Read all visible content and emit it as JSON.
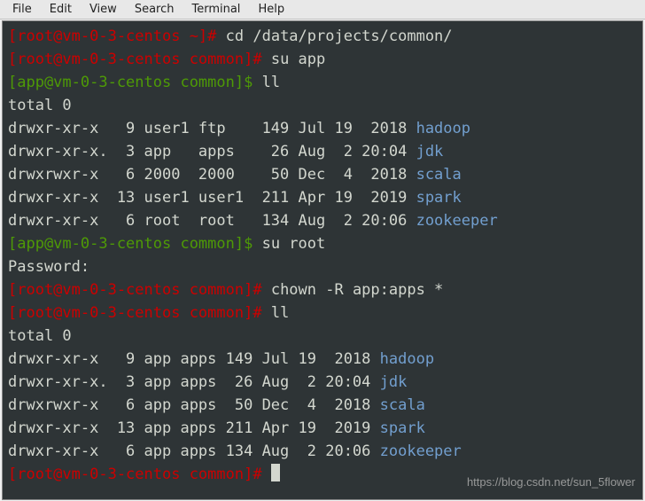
{
  "menubar": {
    "items": [
      "File",
      "Edit",
      "View",
      "Search",
      "Terminal",
      "Help"
    ]
  },
  "terminal": {
    "lines": [
      {
        "type": "prompt_root_home",
        "user": "root",
        "host": "vm-0-3-centos",
        "dir": "~",
        "sym": "#",
        "cmd": "cd /data/projects/common/"
      },
      {
        "type": "prompt_root",
        "user": "root",
        "host": "vm-0-3-centos",
        "dir": "common",
        "sym": "#",
        "cmd": "su app"
      },
      {
        "type": "prompt_app",
        "user": "app",
        "host": "vm-0-3-centos",
        "dir": "common",
        "sym": "$",
        "cmd": "ll"
      },
      {
        "type": "text",
        "text": "total 0"
      },
      {
        "type": "ls",
        "perm": "drwxr-xr-x ",
        "n": "  9",
        "u": "user1",
        "g": "ftp  ",
        "sz": " 149",
        "date": "Jul 19  2018",
        "name": "hadoop"
      },
      {
        "type": "ls",
        "perm": "drwxr-xr-x.",
        "n": "  3",
        "u": "app  ",
        "g": "apps ",
        "sz": "  26",
        "date": "Aug  2 20:04",
        "name": "jdk"
      },
      {
        "type": "ls",
        "perm": "drwxrwxr-x ",
        "n": "  6",
        "u": "2000 ",
        "g": "2000 ",
        "sz": "  50",
        "date": "Dec  4  2018",
        "name": "scala"
      },
      {
        "type": "ls",
        "perm": "drwxr-xr-x ",
        "n": " 13",
        "u": "user1",
        "g": "user1",
        "sz": " 211",
        "date": "Apr 19  2019",
        "name": "spark"
      },
      {
        "type": "ls",
        "perm": "drwxr-xr-x ",
        "n": "  6",
        "u": "root ",
        "g": "root ",
        "sz": " 134",
        "date": "Aug  2 20:06",
        "name": "zookeeper"
      },
      {
        "type": "prompt_app",
        "user": "app",
        "host": "vm-0-3-centos",
        "dir": "common",
        "sym": "$",
        "cmd": "su root"
      },
      {
        "type": "text",
        "text": "Password:"
      },
      {
        "type": "prompt_root",
        "user": "root",
        "host": "vm-0-3-centos",
        "dir": "common",
        "sym": "#",
        "cmd": "chown -R app:apps *"
      },
      {
        "type": "prompt_root",
        "user": "root",
        "host": "vm-0-3-centos",
        "dir": "common",
        "sym": "#",
        "cmd": "ll"
      },
      {
        "type": "text",
        "text": "total 0"
      },
      {
        "type": "ls2",
        "perm": "drwxr-xr-x ",
        "n": "  9",
        "u": "app",
        "g": "apps",
        "sz": " 149",
        "date": "Jul 19  2018",
        "name": "hadoop"
      },
      {
        "type": "ls2",
        "perm": "drwxr-xr-x.",
        "n": "  3",
        "u": "app",
        "g": "apps",
        "sz": "  26",
        "date": "Aug  2 20:04",
        "name": "jdk"
      },
      {
        "type": "ls2",
        "perm": "drwxrwxr-x ",
        "n": "  6",
        "u": "app",
        "g": "apps",
        "sz": "  50",
        "date": "Dec  4  2018",
        "name": "scala"
      },
      {
        "type": "ls2",
        "perm": "drwxr-xr-x ",
        "n": " 13",
        "u": "app",
        "g": "apps",
        "sz": " 211",
        "date": "Apr 19  2019",
        "name": "spark"
      },
      {
        "type": "ls2",
        "perm": "drwxr-xr-x ",
        "n": "  6",
        "u": "app",
        "g": "apps",
        "sz": " 134",
        "date": "Aug  2 20:06",
        "name": "zookeeper"
      },
      {
        "type": "prompt_root_cursor",
        "user": "root",
        "host": "vm-0-3-centos",
        "dir": "common",
        "sym": "#",
        "cmd": ""
      }
    ]
  },
  "watermark": "https://blog.csdn.net/sun_5flower"
}
